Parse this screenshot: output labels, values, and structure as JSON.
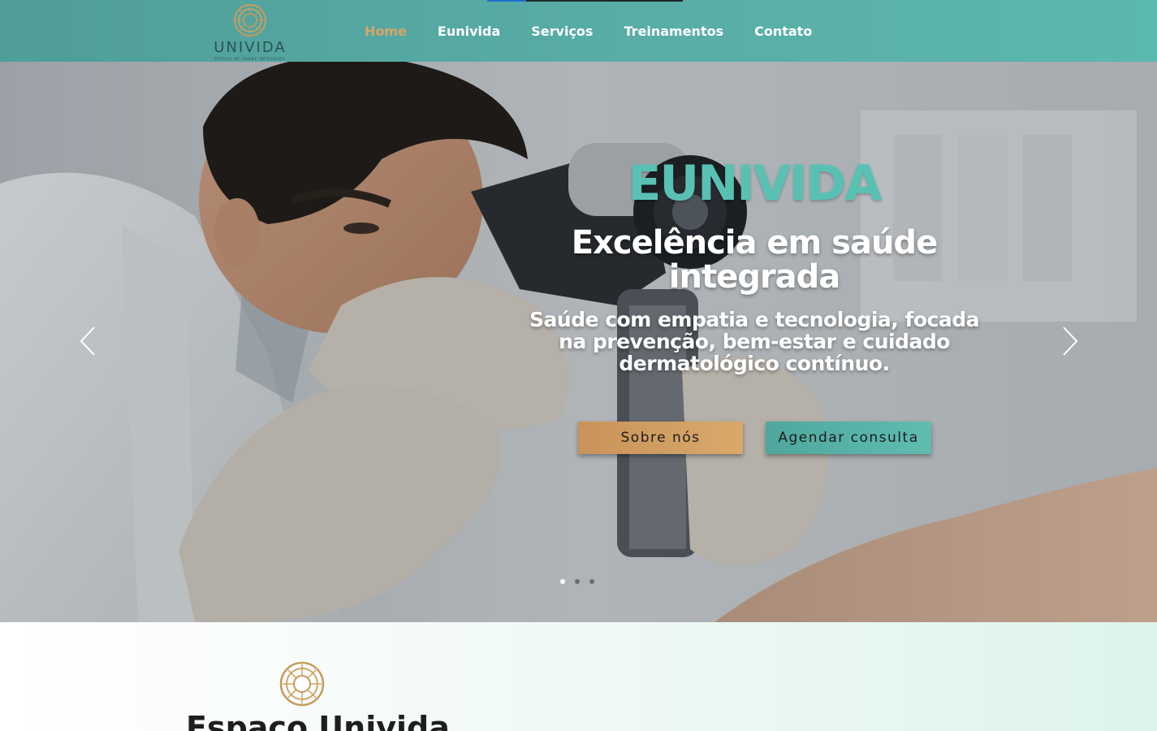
{
  "header": {
    "logo_text": "UNIVIDA",
    "logo_sub": "ESPAÇO DE SAÚDE INTEGRADA",
    "nav": [
      {
        "label": "Home",
        "active": true
      },
      {
        "label": "Eunivida",
        "active": false
      },
      {
        "label": "Serviços",
        "active": false
      },
      {
        "label": "Treinamentos",
        "active": false
      },
      {
        "label": "Contato",
        "active": false
      }
    ],
    "accent_color": "#d6a766",
    "bar_color": "#58aca6"
  },
  "hero": {
    "brand": "EUNIVIDA",
    "title": "Excelência em saúde integrada",
    "subtitle": "Saúde com empatia e tecnologia, focada na prevenção, bem-estar e cuidado dermatológico contínuo.",
    "buttons": {
      "about": "Sobre nós",
      "schedule": "Agendar consulta"
    },
    "prev_icon": "chevron-left-icon",
    "next_icon": "chevron-right-icon",
    "slides_count": 3,
    "active_slide": 1,
    "brand_color": "#59c1b4"
  },
  "about": {
    "title": "Espaço Univida",
    "emblem_icon": "mandala-emblem-icon"
  }
}
